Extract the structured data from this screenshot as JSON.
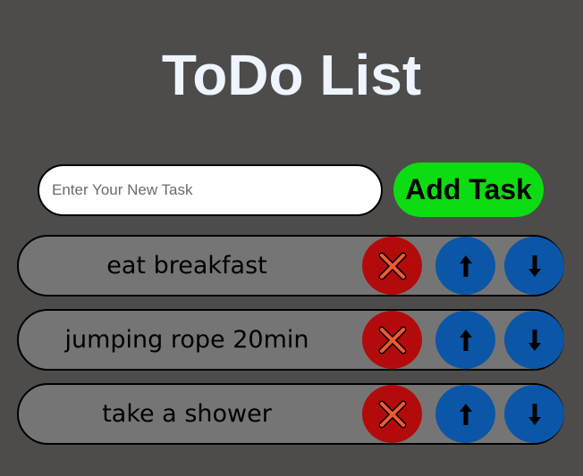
{
  "app": {
    "title": "ToDo List"
  },
  "new_task": {
    "value": "",
    "placeholder": "Enter Your New Task",
    "add_label": "Add Task"
  },
  "tasks": [
    {
      "text": "eat breakfast"
    },
    {
      "text": "jumping rope 20min"
    },
    {
      "text": "take a shower"
    }
  ],
  "icons": {
    "delete": "close-x-icon",
    "up": "arrow-up-icon",
    "down": "arrow-down-icon"
  },
  "colors": {
    "background": "#4d4c4b",
    "title": "#eef5ff",
    "add_button": "#0edc12",
    "task_row": "#767575",
    "delete_button": "#b30b0b",
    "delete_icon": "#f05a32",
    "move_button": "#0b56a7"
  }
}
